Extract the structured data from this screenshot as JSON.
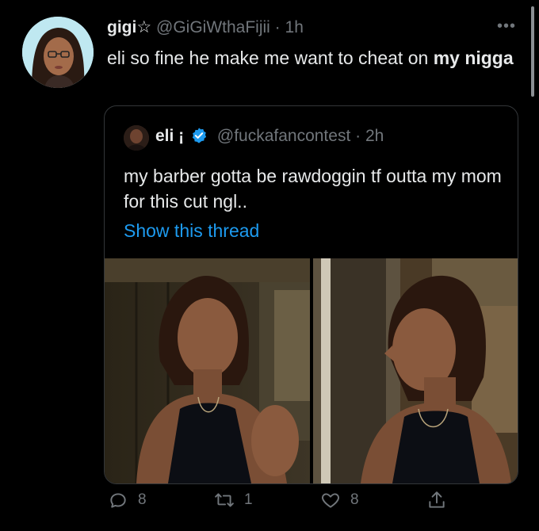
{
  "tweet": {
    "display_name": "gigi☆",
    "handle": "@GiGiWthaFijii",
    "separator": "·",
    "time": "1h",
    "text_part1": "eli so fine he make me want to cheat on ",
    "text_bold": "my nigga",
    "more_icon": "more-dots-icon"
  },
  "quoted": {
    "display_name": "eli ¡",
    "handle": "@fuckafancontest",
    "separator": "·",
    "time": "2h",
    "text": "my barber gotta be rawdoggin tf outta my mom for this cut ngl..",
    "link": "Show this thread",
    "verified_icon": "verified-badge-icon"
  },
  "actions": {
    "reply_count": "8",
    "retweet_count": "1",
    "like_count": "8"
  },
  "colors": {
    "background": "#000000",
    "text": "#e7e9ea",
    "muted": "#71767b",
    "link": "#1d9bf0",
    "border": "#333639"
  }
}
